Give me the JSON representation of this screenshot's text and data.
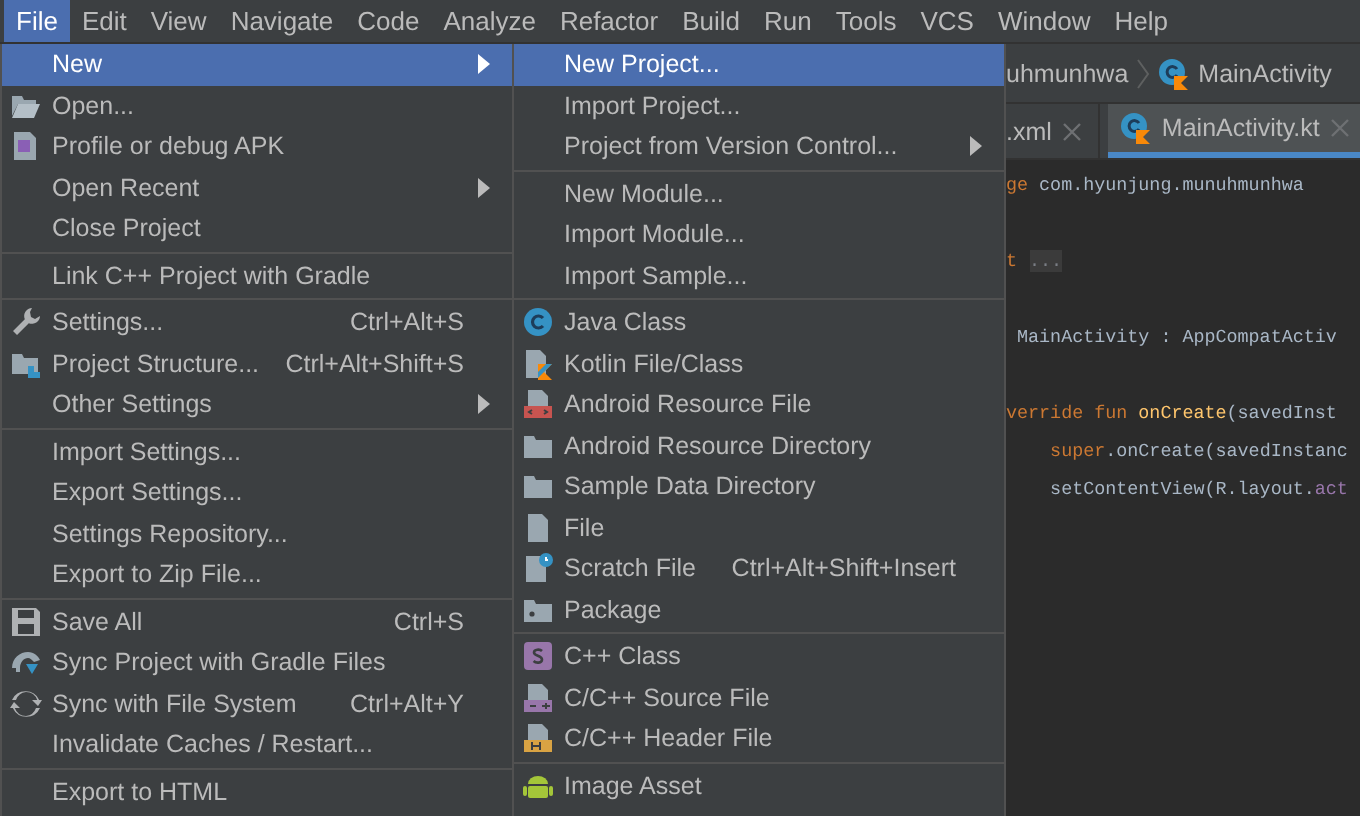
{
  "menubar": [
    {
      "label": "File",
      "selected": true
    },
    {
      "label": "Edit",
      "selected": false
    },
    {
      "label": "View",
      "selected": false
    },
    {
      "label": "Navigate",
      "selected": false
    },
    {
      "label": "Code",
      "selected": false
    },
    {
      "label": "Analyze",
      "selected": false
    },
    {
      "label": "Refactor",
      "selected": false
    },
    {
      "label": "Build",
      "selected": false
    },
    {
      "label": "Run",
      "selected": false
    },
    {
      "label": "Tools",
      "selected": false
    },
    {
      "label": "VCS",
      "selected": false
    },
    {
      "label": "Window",
      "selected": false
    },
    {
      "label": "Help",
      "selected": false
    }
  ],
  "file_menu": {
    "items": [
      {
        "kind": "item",
        "label": "New",
        "selected": true,
        "has_submenu": true
      },
      {
        "kind": "item",
        "label": "Open...",
        "selected": false,
        "has_submenu": false
      },
      {
        "kind": "item",
        "label": "Profile or debug APK",
        "selected": false,
        "has_submenu": false
      },
      {
        "kind": "item",
        "label": "Open Recent",
        "selected": false,
        "has_submenu": true
      },
      {
        "kind": "item",
        "label": "Close Project",
        "selected": false,
        "has_submenu": false
      },
      {
        "kind": "separator"
      },
      {
        "kind": "item",
        "label": "Link C++ Project with Gradle",
        "selected": false,
        "has_submenu": false
      },
      {
        "kind": "separator"
      },
      {
        "kind": "item",
        "label": "Settings...",
        "shortcut": "Ctrl+Alt+S",
        "selected": false,
        "has_submenu": false
      },
      {
        "kind": "item",
        "label": "Project Structure...",
        "shortcut": "Ctrl+Alt+Shift+S",
        "selected": false,
        "has_submenu": false
      },
      {
        "kind": "item",
        "label": "Other Settings",
        "selected": false,
        "has_submenu": true
      },
      {
        "kind": "separator"
      },
      {
        "kind": "item",
        "label": "Import Settings...",
        "selected": false,
        "has_submenu": false
      },
      {
        "kind": "item",
        "label": "Export Settings...",
        "selected": false,
        "has_submenu": false
      },
      {
        "kind": "item",
        "label": "Settings Repository...",
        "selected": false,
        "has_submenu": false
      },
      {
        "kind": "item",
        "label": "Export to Zip File...",
        "selected": false,
        "has_submenu": false
      },
      {
        "kind": "separator"
      },
      {
        "kind": "item",
        "label": "Save All",
        "shortcut": "Ctrl+S",
        "selected": false,
        "has_submenu": false
      },
      {
        "kind": "item",
        "label": "Sync Project with Gradle Files",
        "selected": false,
        "has_submenu": false
      },
      {
        "kind": "item",
        "label": "Sync with File System",
        "shortcut": "Ctrl+Alt+Y",
        "selected": false,
        "has_submenu": false
      },
      {
        "kind": "item",
        "label": "Invalidate Caches / Restart...",
        "selected": false,
        "has_submenu": false
      },
      {
        "kind": "separator"
      },
      {
        "kind": "item",
        "label": "Export to HTML",
        "selected": false,
        "has_submenu": false
      }
    ]
  },
  "new_submenu": {
    "items": [
      {
        "kind": "item",
        "label": "New Project...",
        "selected": true,
        "has_submenu": false
      },
      {
        "kind": "item",
        "label": "Import Project...",
        "selected": false,
        "has_submenu": false
      },
      {
        "kind": "item",
        "label": "Project from Version Control...",
        "selected": false,
        "has_submenu": true
      },
      {
        "kind": "separator"
      },
      {
        "kind": "item",
        "label": "New Module...",
        "selected": false,
        "has_submenu": false
      },
      {
        "kind": "item",
        "label": "Import Module...",
        "selected": false,
        "has_submenu": false
      },
      {
        "kind": "item",
        "label": "Import Sample...",
        "selected": false,
        "has_submenu": false
      },
      {
        "kind": "separator"
      },
      {
        "kind": "item",
        "label": "Java Class",
        "selected": false,
        "has_submenu": false
      },
      {
        "kind": "item",
        "label": "Kotlin File/Class",
        "selected": false,
        "has_submenu": false
      },
      {
        "kind": "item",
        "label": "Android Resource File",
        "selected": false,
        "has_submenu": false
      },
      {
        "kind": "item",
        "label": "Android Resource Directory",
        "selected": false,
        "has_submenu": false
      },
      {
        "kind": "item",
        "label": "Sample Data Directory",
        "selected": false,
        "has_submenu": false
      },
      {
        "kind": "item",
        "label": "File",
        "selected": false,
        "has_submenu": false
      },
      {
        "kind": "item",
        "label": "Scratch File",
        "shortcut": "Ctrl+Alt+Shift+Insert",
        "selected": false,
        "has_submenu": false
      },
      {
        "kind": "item",
        "label": "Package",
        "selected": false,
        "has_submenu": false
      },
      {
        "kind": "separator"
      },
      {
        "kind": "item",
        "label": "C++ Class",
        "selected": false,
        "has_submenu": false
      },
      {
        "kind": "item",
        "label": "C/C++ Source File",
        "selected": false,
        "has_submenu": false
      },
      {
        "kind": "item",
        "label": "C/C++ Header File",
        "selected": false,
        "has_submenu": false
      },
      {
        "kind": "separator"
      },
      {
        "kind": "item",
        "label": "Image Asset",
        "selected": false,
        "has_submenu": false
      }
    ]
  },
  "breadcrumbs": [
    "uhmunhwa",
    "MainActivity"
  ],
  "tabs": [
    {
      "label": ".xml",
      "selected": false
    },
    {
      "label": "MainActivity.kt",
      "selected": true
    }
  ],
  "code_lines": [
    {
      "kind": "code",
      "segments": [
        {
          "text": "ge",
          "kind": "keyword"
        },
        {
          "text": " com.hyunjung.munuhmunhwa",
          "kind": "plain"
        }
      ]
    },
    {
      "kind": "blank"
    },
    {
      "kind": "code",
      "segments": [
        {
          "text": "t",
          "kind": "keyword"
        },
        {
          "text": "...",
          "kind": "folded"
        }
      ]
    },
    {
      "kind": "blank"
    },
    {
      "kind": "code",
      "segments": [
        {
          "text": " MainActivity : AppCompatActiv",
          "kind": "plain"
        }
      ]
    },
    {
      "kind": "blank"
    },
    {
      "kind": "code",
      "segments": [
        {
          "text": "verride fun",
          "kind": "keyword"
        },
        {
          "text": " onCreate",
          "kind": "function"
        },
        {
          "text": "(savedInst",
          "kind": "plain"
        }
      ]
    },
    {
      "kind": "code",
      "segments": [
        {
          "text": "    super",
          "kind": "keyword"
        },
        {
          "text": ".onCreate(savedInstanc",
          "kind": "plain"
        }
      ]
    },
    {
      "kind": "code",
      "segments": [
        {
          "text": "    setContentView(R.layout.",
          "kind": "plain"
        },
        {
          "text": "act",
          "kind": "property"
        }
      ]
    }
  ]
}
